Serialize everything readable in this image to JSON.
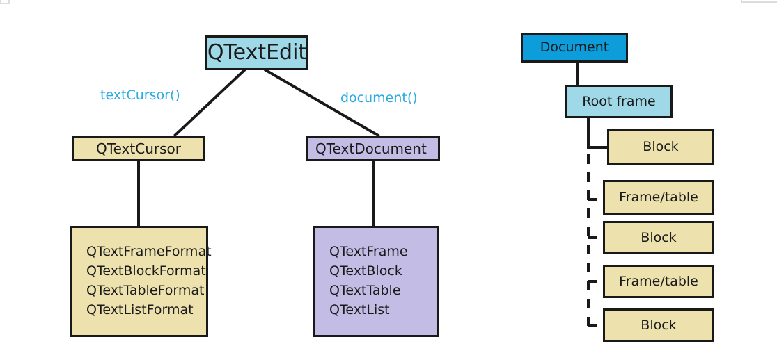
{
  "diagram": {
    "title": "Qt rich text class and document structure diagram",
    "colors": {
      "cyan_box": "#9FD9E8",
      "cream_box": "#EDE2AE",
      "purple_box": "#C3BDE5",
      "blue_box": "#0D9DDB",
      "border": "#191919",
      "label_text": "#29ABE2",
      "body_text": "#1a1a1a",
      "artifact_gray": "#dcdcdc",
      "background": "#ffffff"
    },
    "left_tree": {
      "root": {
        "label": "QTextEdit"
      },
      "edge_labels": [
        {
          "text": "textCursor()"
        },
        {
          "text": "document()"
        }
      ],
      "children": [
        {
          "label": "QTextCursor"
        },
        {
          "label": "QTextDocument"
        }
      ],
      "leaf_groups": [
        {
          "items": [
            "QTextFrameFormat",
            "QTextBlockFormat",
            "QTextTableFormat",
            "QTextListFormat"
          ]
        },
        {
          "items": [
            "QTextFrame",
            "QTextBlock",
            "QTextTable",
            "QTextList"
          ]
        }
      ]
    },
    "right_tree": {
      "root": {
        "label": "Document"
      },
      "frame": {
        "label": "Root frame"
      },
      "children": [
        {
          "label": "Block"
        },
        {
          "label": "Frame/table"
        },
        {
          "label": "Block"
        },
        {
          "label": "Frame/table"
        },
        {
          "label": "Block"
        }
      ]
    }
  }
}
